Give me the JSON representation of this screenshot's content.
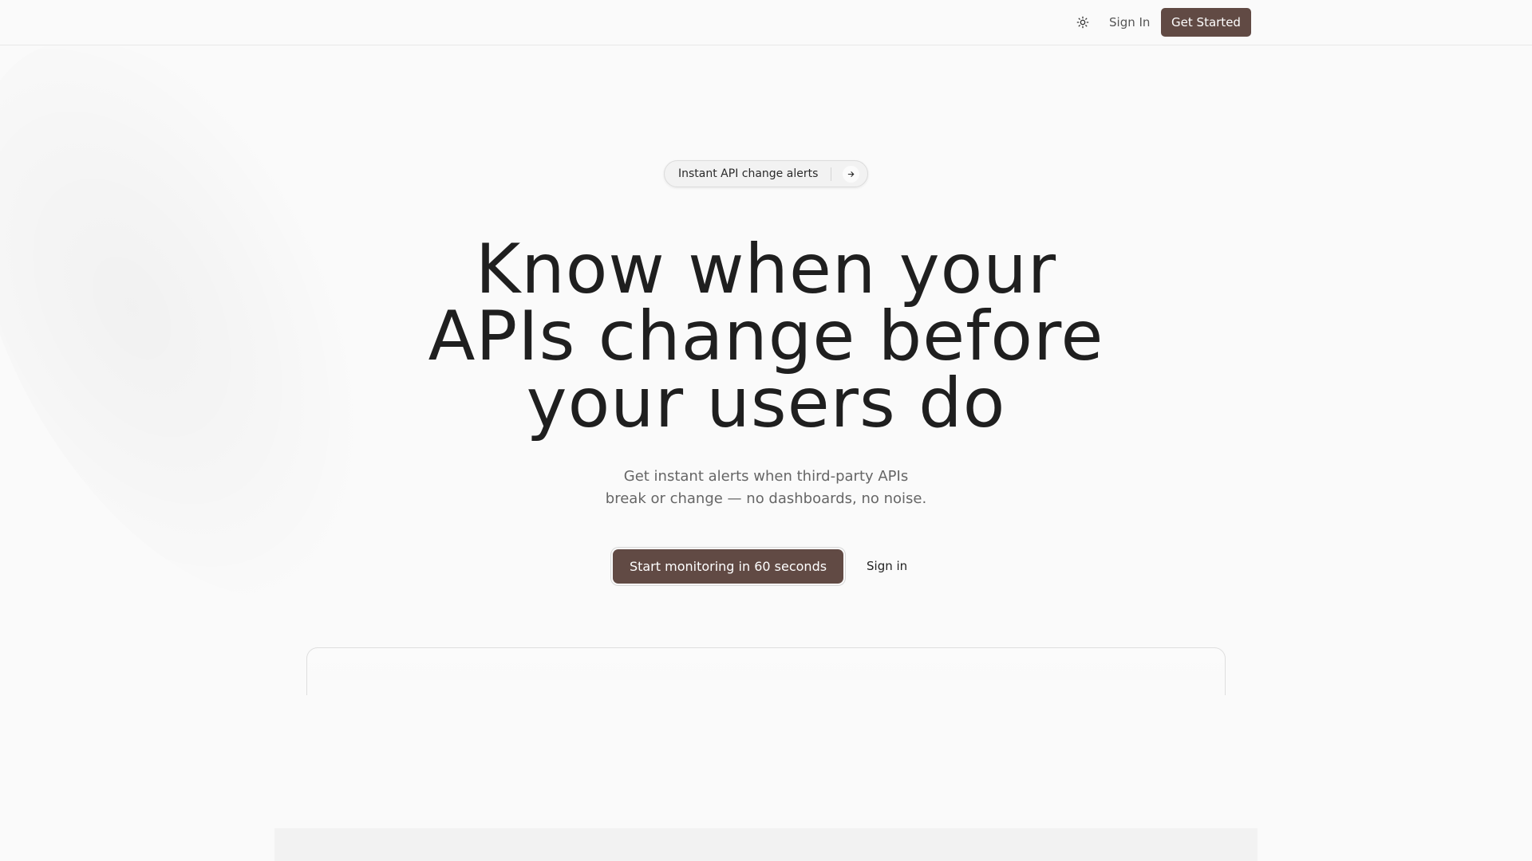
{
  "header": {
    "theme_toggle_icon": "sun-icon",
    "sign_in_label": "Sign In",
    "get_started_label": "Get Started"
  },
  "announcement": {
    "label": "Instant API change alerts",
    "arrow_icon": "arrow-right-icon"
  },
  "hero": {
    "headline_lines": [
      "Know when your",
      "APIs change before",
      "your users do"
    ],
    "subtext_lines": [
      "Get instant alerts when third-party APIs",
      "break or change — no dashboards, no noise."
    ],
    "primary_cta_label": "Start monitoring in 60 seconds",
    "secondary_cta_label": "Sign in"
  },
  "colors": {
    "accent": "#614a44",
    "background": "#fafafa",
    "text": "#1f1f1f",
    "muted_text": "#666666"
  }
}
